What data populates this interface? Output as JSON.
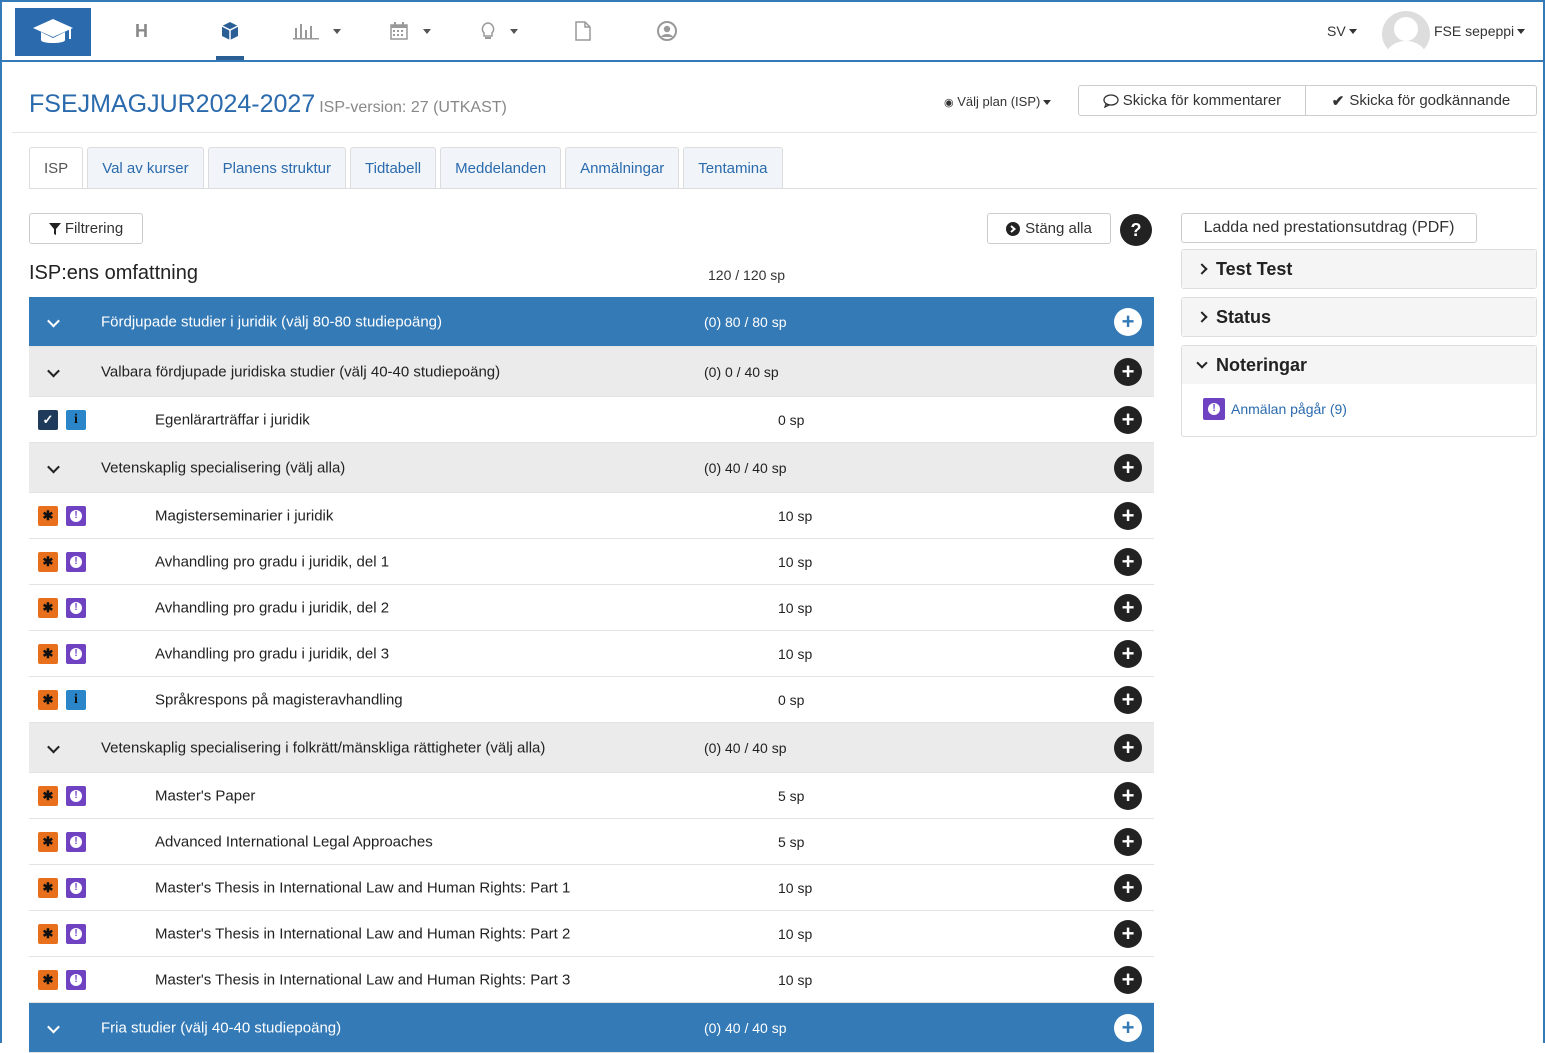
{
  "nav": {
    "home_label": "H",
    "language": "SV",
    "user": "FSE sepeppi",
    "icons": [
      "graduation-cap-icon",
      "home-letter",
      "cube-icon",
      "bar-chart-icon",
      "calendar-icon",
      "lightbulb-icon",
      "document-icon",
      "user-circle-icon"
    ]
  },
  "header": {
    "plan_code": "FSEJMAGJUR2024-2027",
    "version_text": "ISP-version: 27 (UTKAST)",
    "choose_plan": "Välj plan (ISP)",
    "send_comments": "Skicka för kommentarer",
    "send_approval": "Skicka för godkännande"
  },
  "tabs": [
    "ISP",
    "Val av kurser",
    "Planens struktur",
    "Tidtabell",
    "Meddelanden",
    "Anmälningar",
    "Tentamina"
  ],
  "toolbar": {
    "filter": "Filtrering",
    "close_all": "Stäng alla",
    "help": "?"
  },
  "scope": {
    "title": "ISP:ens omfattning",
    "total": "120 / 120 sp"
  },
  "tree": [
    {
      "type": "grp1",
      "name": "Fördjupade studier i juridik (välj 80-80 studiepoäng)",
      "sp": "(0) 80 / 80 sp"
    },
    {
      "type": "grp2",
      "name": "Valbara fördjupade juridiska studier (välj 40-40 studiepoäng)",
      "sp": "(0) 0 / 40 sp"
    },
    {
      "type": "course",
      "badges": [
        "check",
        "info"
      ],
      "name": "Egenlärarträffar i juridik",
      "sp": "0 sp"
    },
    {
      "type": "grp2",
      "name": "Vetenskaplig specialisering (välj alla)",
      "sp": "(0) 40 / 40 sp"
    },
    {
      "type": "course",
      "badges": [
        "star",
        "warn"
      ],
      "name": "Magisterseminarier i juridik",
      "sp": "10 sp"
    },
    {
      "type": "course",
      "badges": [
        "star",
        "warn"
      ],
      "name": "Avhandling pro gradu i juridik, del 1",
      "sp": "10 sp"
    },
    {
      "type": "course",
      "badges": [
        "star",
        "warn"
      ],
      "name": "Avhandling pro gradu i juridik, del 2",
      "sp": "10 sp"
    },
    {
      "type": "course",
      "badges": [
        "star",
        "warn"
      ],
      "name": "Avhandling pro gradu i juridik, del 3",
      "sp": "10 sp"
    },
    {
      "type": "course",
      "badges": [
        "star",
        "info"
      ],
      "name": "Språkrespons på magisteravhandling",
      "sp": "0 sp"
    },
    {
      "type": "grp2",
      "name": "Vetenskaplig specialisering i folkrätt/mänskliga rättigheter (välj alla)",
      "sp": "(0) 40 / 40 sp"
    },
    {
      "type": "course",
      "badges": [
        "star",
        "warn"
      ],
      "name": "Master's Paper",
      "sp": "5 sp"
    },
    {
      "type": "course",
      "badges": [
        "star",
        "warn"
      ],
      "name": "Advanced International Legal Approaches",
      "sp": "5 sp"
    },
    {
      "type": "course",
      "badges": [
        "star",
        "warn"
      ],
      "name": "Master's Thesis in International Law and Human Rights: Part 1",
      "sp": "10 sp"
    },
    {
      "type": "course",
      "badges": [
        "star",
        "warn"
      ],
      "name": "Master's Thesis in International Law and Human Rights: Part 2",
      "sp": "10 sp"
    },
    {
      "type": "course",
      "badges": [
        "star",
        "warn"
      ],
      "name": "Master's Thesis in International Law and Human Rights: Part 3",
      "sp": "10 sp"
    },
    {
      "type": "grp1",
      "name": "Fria studier (välj 40-40 studiepoäng)",
      "sp": "(0) 40 / 40 sp"
    }
  ],
  "sidebar": {
    "download": "Ladda ned prestationsutdrag (PDF)",
    "panels": [
      "Test Test",
      "Status",
      "Noteringar"
    ],
    "note": "Anmälan pågår (9)"
  },
  "colors": {
    "primary": "#337ab7",
    "group_bg": "#ebebeb",
    "star": "#e8701c",
    "warn": "#6f42c1",
    "info": "#2a86c9"
  }
}
